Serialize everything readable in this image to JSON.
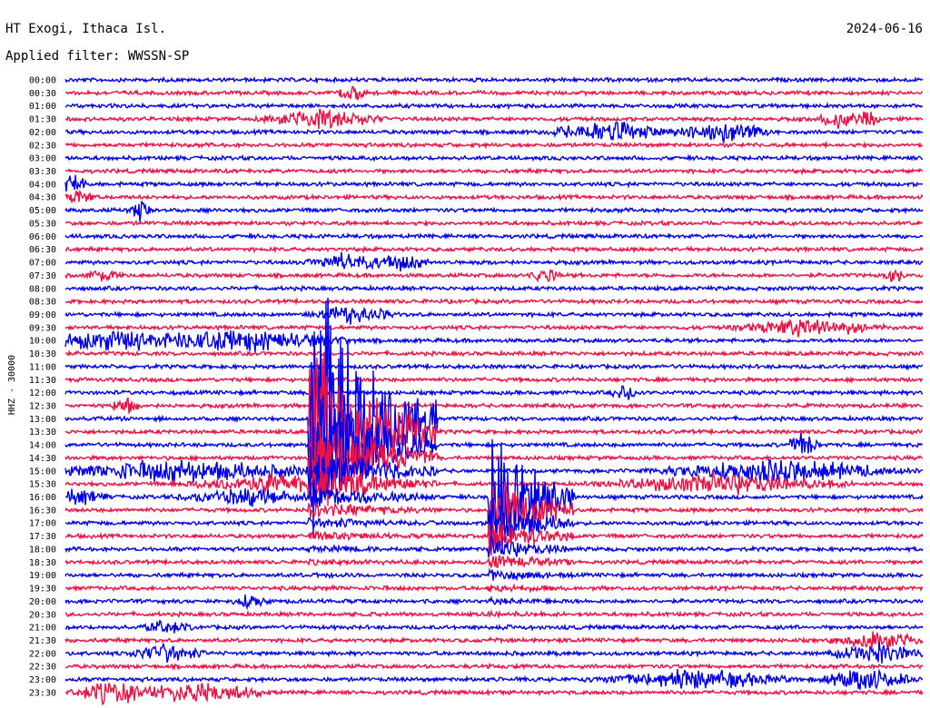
{
  "header": {
    "station": "HT Exogi, Ithaca Isl.",
    "date": "2024-06-16",
    "filter": "Applied filter: WWSSN-SP"
  },
  "chart_data": {
    "type": "line",
    "title": "HT Exogi, Ithaca Isl.",
    "ylabel": "HHZ - 30000",
    "row_labels": [
      "00:00",
      "00:30",
      "01:00",
      "01:30",
      "02:00",
      "02:30",
      "03:00",
      "03:30",
      "04:00",
      "04:30",
      "05:00",
      "05:30",
      "06:00",
      "06:30",
      "07:00",
      "07:30",
      "08:00",
      "08:30",
      "09:00",
      "09:30",
      "10:00",
      "10:30",
      "11:00",
      "11:30",
      "12:00",
      "12:30",
      "13:00",
      "13:30",
      "14:00",
      "14:30",
      "15:00",
      "15:30",
      "16:00",
      "16:30",
      "17:00",
      "17:30",
      "18:00",
      "18:30",
      "19:00",
      "19:30",
      "20:00",
      "20:30",
      "21:00",
      "21:30",
      "22:00",
      "22:30",
      "23:00",
      "23:30"
    ],
    "colors": [
      "#0000ee",
      "#ee1144"
    ],
    "row_minutes": 30,
    "bursts": [
      {
        "row": 1,
        "minute": 10,
        "width_min": 0.6,
        "amp": 12
      },
      {
        "row": 3,
        "minute": 9,
        "width_min": 2.5,
        "amp": 12
      },
      {
        "row": 3,
        "minute": 27,
        "width_min": 0.8,
        "amp": 12
      },
      {
        "row": 3,
        "minute": 28,
        "width_min": 0.6,
        "amp": 11
      },
      {
        "row": 4,
        "minute": 19,
        "width_min": 2.5,
        "amp": 13
      },
      {
        "row": 4,
        "minute": 23,
        "width_min": 2,
        "amp": 14
      },
      {
        "row": 8,
        "minute": 0.3,
        "width_min": 0.5,
        "amp": 16
      },
      {
        "row": 9,
        "minute": 0.5,
        "width_min": 0.6,
        "amp": 10
      },
      {
        "row": 10,
        "minute": 2.6,
        "width_min": 0.5,
        "amp": 14
      },
      {
        "row": 14,
        "minute": 9.8,
        "width_min": 1.5,
        "amp": 12
      },
      {
        "row": 14,
        "minute": 11.8,
        "width_min": 1.2,
        "amp": 10
      },
      {
        "row": 15,
        "minute": 1.3,
        "width_min": 0.8,
        "amp": 8
      },
      {
        "row": 15,
        "minute": 16.8,
        "width_min": 0.6,
        "amp": 9
      },
      {
        "row": 15,
        "minute": 29,
        "width_min": 0.5,
        "amp": 10
      },
      {
        "row": 18,
        "minute": 10,
        "width_min": 1.8,
        "amp": 11
      },
      {
        "row": 19,
        "minute": 26,
        "width_min": 3,
        "amp": 11
      },
      {
        "row": 20,
        "minute": 1.5,
        "width_min": 4,
        "amp": 12
      },
      {
        "row": 20,
        "minute": 6.5,
        "width_min": 4,
        "amp": 13
      },
      {
        "row": 24,
        "minute": 19.6,
        "width_min": 0.6,
        "amp": 9
      },
      {
        "row": 25,
        "minute": 2.1,
        "width_min": 0.6,
        "amp": 12
      },
      {
        "row": 26,
        "minute": 12.4,
        "width_min": 0.5,
        "amp": 12
      },
      {
        "row": 28,
        "minute": 25.8,
        "width_min": 0.6,
        "amp": 18
      },
      {
        "row": 30,
        "minute": 4.2,
        "width_min": 6,
        "amp": 14
      },
      {
        "row": 30,
        "minute": 25,
        "width_min": 5,
        "amp": 14
      },
      {
        "row": 31,
        "minute": 7.5,
        "width_min": 4,
        "amp": 12
      },
      {
        "row": 31,
        "minute": 23,
        "width_min": 5,
        "amp": 13
      },
      {
        "row": 32,
        "minute": 0.5,
        "width_min": 1.2,
        "amp": 9
      },
      {
        "row": 32,
        "minute": 6.5,
        "width_min": 3,
        "amp": 10
      },
      {
        "row": 40,
        "minute": 6.5,
        "width_min": 0.8,
        "amp": 8
      },
      {
        "row": 42,
        "minute": 3.5,
        "width_min": 1,
        "amp": 9
      },
      {
        "row": 43,
        "minute": 28.5,
        "width_min": 2,
        "amp": 11
      },
      {
        "row": 44,
        "minute": 3.5,
        "width_min": 1.5,
        "amp": 12
      },
      {
        "row": 44,
        "minute": 28.5,
        "width_min": 2,
        "amp": 12
      },
      {
        "row": 46,
        "minute": 22,
        "width_min": 4,
        "amp": 12
      },
      {
        "row": 46,
        "minute": 28,
        "width_min": 2,
        "amp": 14
      },
      {
        "row": 47,
        "minute": 1.5,
        "width_min": 1.5,
        "amp": 13
      },
      {
        "row": 47,
        "minute": 4.5,
        "width_min": 3,
        "amp": 13
      }
    ],
    "quakes": [
      {
        "row": 26,
        "minute": 8.5,
        "amp": 200,
        "decay_min": 4.5
      },
      {
        "row": 32,
        "minute": 14.8,
        "amp": 90,
        "decay_min": 3
      }
    ]
  }
}
